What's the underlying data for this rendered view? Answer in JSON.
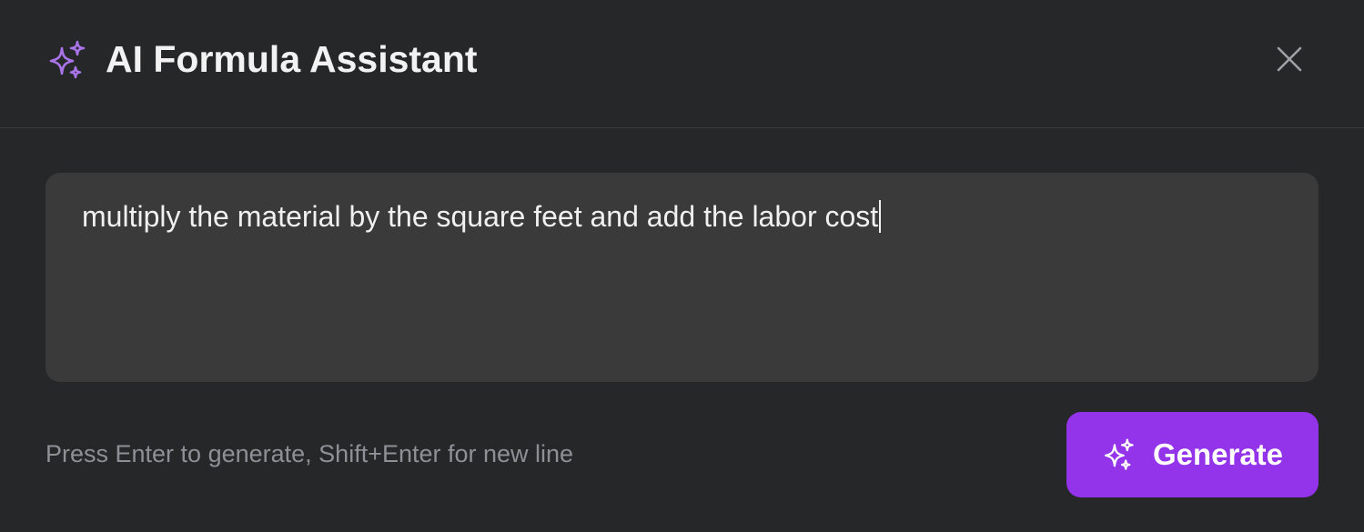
{
  "dialog": {
    "title": "AI Formula Assistant",
    "title_icon": "sparkles-icon",
    "close_icon": "close-icon"
  },
  "prompt_input": {
    "value": "multiply the material by the square feet and add the labor cost"
  },
  "footer": {
    "hint": "Press Enter to generate, Shift+Enter for new line",
    "generate_label": "Generate",
    "generate_icon": "sparkles-icon"
  },
  "colors": {
    "background": "#262729",
    "input_background": "#3a3a3b",
    "accent": "#9333ea",
    "icon_accent": "#a874e8",
    "hint_text": "#8f9096"
  }
}
